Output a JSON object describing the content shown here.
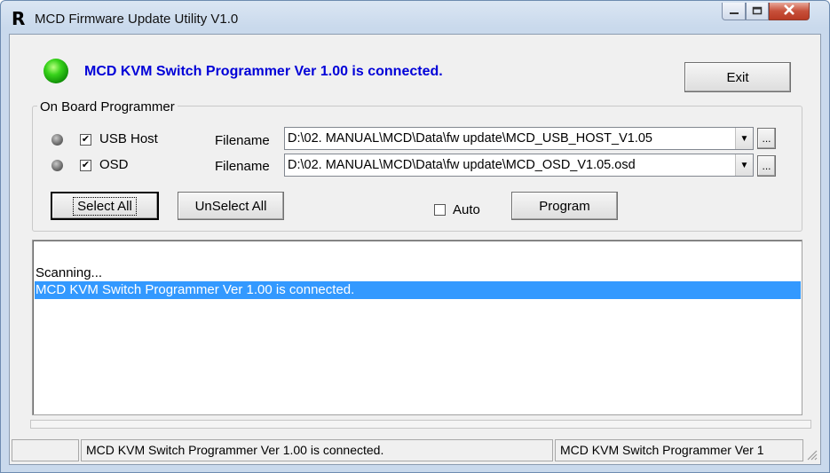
{
  "window": {
    "title": "MCD Firmware Update Utility V1.0",
    "icon_letter": "R",
    "controls": {
      "minimize_icon": "minimize-icon",
      "maximize_icon": "maximize-icon",
      "close_icon": "close-icon"
    }
  },
  "header": {
    "status_message": "MCD KVM Switch Programmer Ver 1.00 is connected.",
    "status_led_color": "#2ecc1a",
    "exit_label": "Exit"
  },
  "programmer_group": {
    "label": "On Board Programmer",
    "rows": [
      {
        "name": "USB Host",
        "checked": true,
        "filename_label": "Filename",
        "filename": "D:\\02. MANUAL\\MCD\\Data\\fw update\\MCD_USB_HOST_V1.05",
        "browse_label": "..."
      },
      {
        "name": "OSD",
        "checked": true,
        "filename_label": "Filename",
        "filename": "D:\\02. MANUAL\\MCD\\Data\\fw update\\MCD_OSD_V1.05.osd",
        "browse_label": "..."
      }
    ],
    "select_all_label": "Select All",
    "unselect_all_label": "UnSelect All",
    "auto_label": "Auto",
    "auto_checked": false,
    "program_label": "Program"
  },
  "log": {
    "lines": [
      {
        "text": "",
        "selected": false
      },
      {
        "text": "Scanning...",
        "selected": false
      },
      {
        "text": "MCD KVM Switch Programmer Ver 1.00 is connected.",
        "selected": true
      }
    ],
    "selection_color": "#3399ff"
  },
  "statusbar": {
    "cells": [
      "",
      "MCD KVM Switch Programmer Ver 1.00 is connected.",
      "MCD KVM Switch Programmer Ver 1"
    ]
  }
}
